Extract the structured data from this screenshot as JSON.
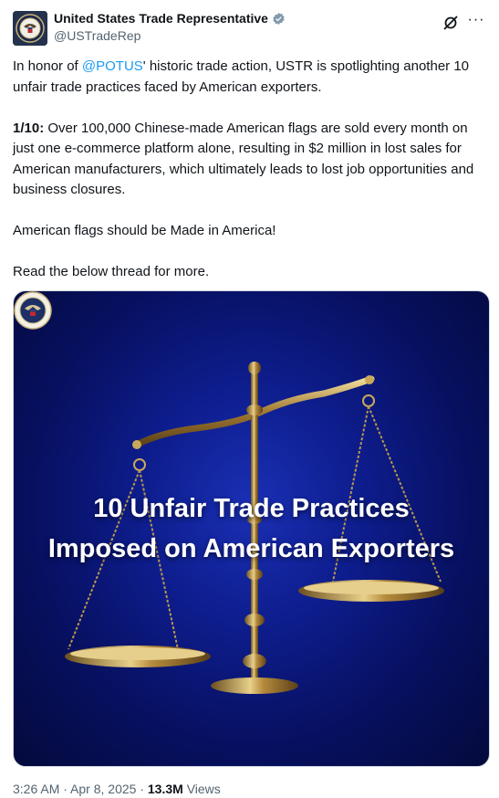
{
  "author": {
    "display_name": "United States Trade Representative",
    "handle": "@USTradeRep",
    "verified_icon": "verified-badge-icon"
  },
  "tweet": {
    "para1_prefix": "In honor of ",
    "mention": "@POTUS",
    "para1_suffix": "' historic trade action, USTR is spotlighting another 10 unfair trade practices faced by American exporters.",
    "para2_bold": "1/10:",
    "para2_text": " Over 100,000 Chinese-made American flags are sold every month on just one e-commerce platform alone, resulting in $2 million in lost sales for American manufacturers, which ultimately leads to lost job opportunities and business closures.",
    "para3": "American flags should be Made in America!",
    "para4": "Read the below thread for more."
  },
  "media": {
    "title_line1": "10 Unfair Trade Practices",
    "title_line2": "Imposed on American Exporters"
  },
  "meta": {
    "time": "3:26 AM",
    "sep1": " · ",
    "date": "Apr 8, 2025",
    "sep2": " · ",
    "views_count": "13.3M",
    "views_label": " Views"
  },
  "colors": {
    "link": "#1d9bf0",
    "secondary_text": "#536471",
    "verified": "#829aab"
  }
}
